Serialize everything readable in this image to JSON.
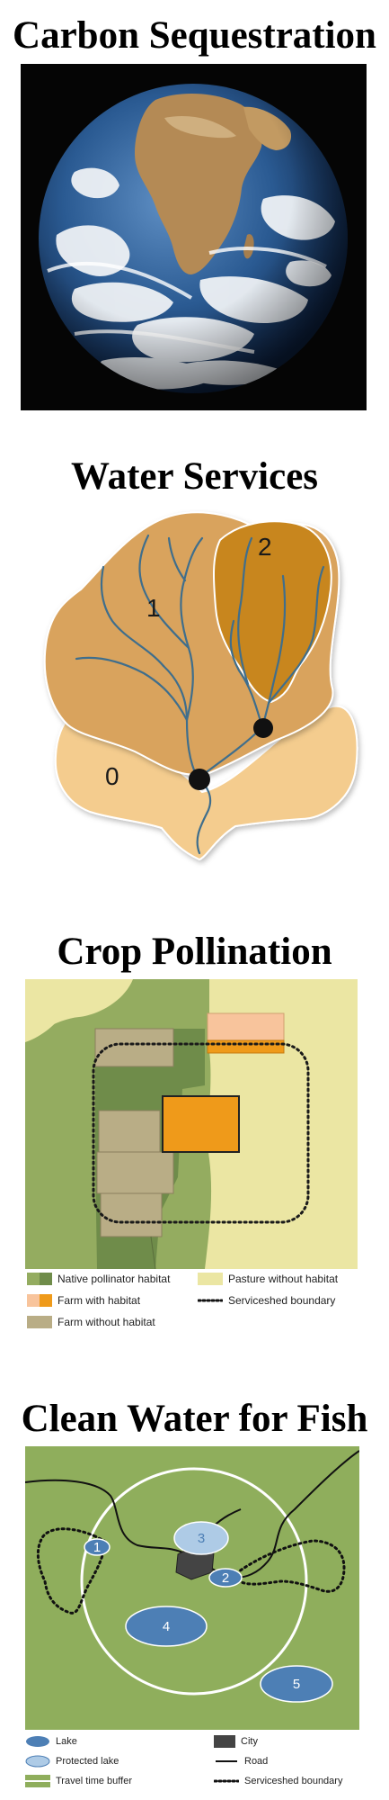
{
  "sections": {
    "carbon": {
      "title": "Carbon Sequestration"
    },
    "water": {
      "title": "Water Services",
      "zone_labels": [
        "1",
        "2",
        "0"
      ]
    },
    "pollination": {
      "title": "Crop Pollination",
      "legend": [
        "Native pollinator habitat",
        "Pasture without habitat",
        "Farm with habitat",
        "Serviceshed boundary",
        "Farm without habitat"
      ]
    },
    "fish": {
      "title": "Clean Water for Fish",
      "lake_labels": [
        "1",
        "2",
        "3",
        "4",
        "5"
      ],
      "legend": [
        "Lake",
        "City",
        "Protected lake",
        "Road",
        "Travel time buffer",
        "Serviceshed boundary"
      ]
    }
  },
  "colors": {
    "space": "#050505",
    "ocean": "#1f4f8a",
    "watershed_0": "#f4cc8e",
    "watershed_1": "#d9a35d",
    "watershed_2": "#c8861e",
    "river": "#3f6e8c",
    "native_habitat": "#6f8c4a",
    "pasture": "#ebe6a3",
    "farm_orange": "#ef9a1a",
    "farm_tan": "#b9ad86",
    "fish_background": "#8fae5c",
    "lake": "#4d7fb5",
    "protected_lake": "#aecbe6",
    "city": "#444444"
  }
}
